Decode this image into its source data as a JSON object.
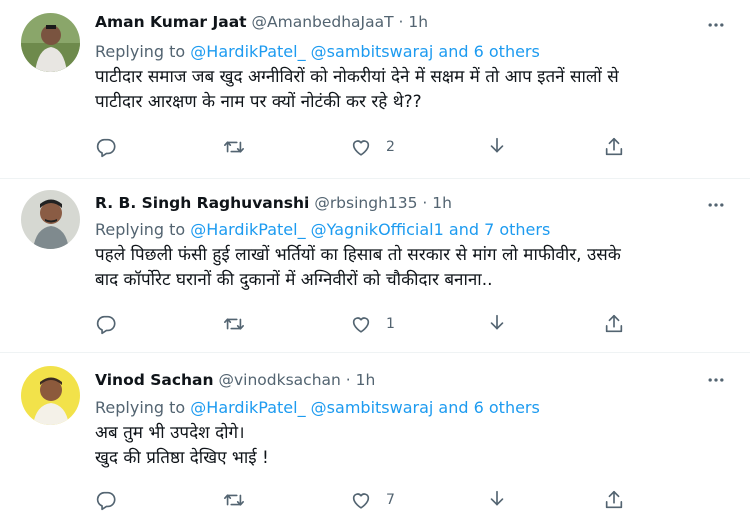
{
  "tweets": [
    {
      "author_name": "Aman Kumar Jaat",
      "handle": "@AmanbedhaJaaT",
      "dot": "·",
      "time": "1h",
      "replying_prefix": "Replying to",
      "replying_to": "@HardikPatel_ @sambitswaraj and 6 others",
      "text_lines": [
        "पाटीदार समाज जब खुद अग्नीविरों को नोकरीयां देने में सक्षम में तो आप इतनें सालों से",
        "पाटीदार आरक्षण के नाम पर क्यों नोटंकी कर रहे थे??"
      ],
      "reply_count": "",
      "retweet_count": "",
      "like_count": "2"
    },
    {
      "author_name": "R. B. Singh Raghuvanshi",
      "handle": "@rbsingh135",
      "dot": "·",
      "time": "1h",
      "replying_prefix": "Replying to",
      "replying_to": "@HardikPatel_ @YagnikOfficial1 and 7 others",
      "text_lines": [
        "पहले पिछली फंसी हुई लाखों भर्तियों का हिसाब तो सरकार से मांग लो माफीवीर, उसके",
        "बाद कॉर्पोरेट घरानों की दुकानों में अग्निवीरों को चौकीदार बनाना.."
      ],
      "reply_count": "",
      "retweet_count": "",
      "like_count": "1"
    },
    {
      "author_name": "Vinod Sachan",
      "handle": "@vinodksachan",
      "dot": "·",
      "time": "1h",
      "replying_prefix": "Replying to",
      "replying_to": "@HardikPatel_ @sambitswaraj and 6 others",
      "text_lines": [
        "अब तुम भी उपदेश दोगे।",
        "खुद की प्रतिष्ठा देखिए भाई !"
      ],
      "reply_count": "",
      "retweet_count": "",
      "like_count": "7"
    }
  ],
  "icons": [
    "more-icon",
    "reply-icon",
    "retweet-icon",
    "like-icon",
    "download-icon",
    "share-icon"
  ],
  "colors": {
    "link": "#1d9bf0",
    "secondary_text": "#536471",
    "primary_text": "#0f1419",
    "divider": "#eff3f4"
  }
}
